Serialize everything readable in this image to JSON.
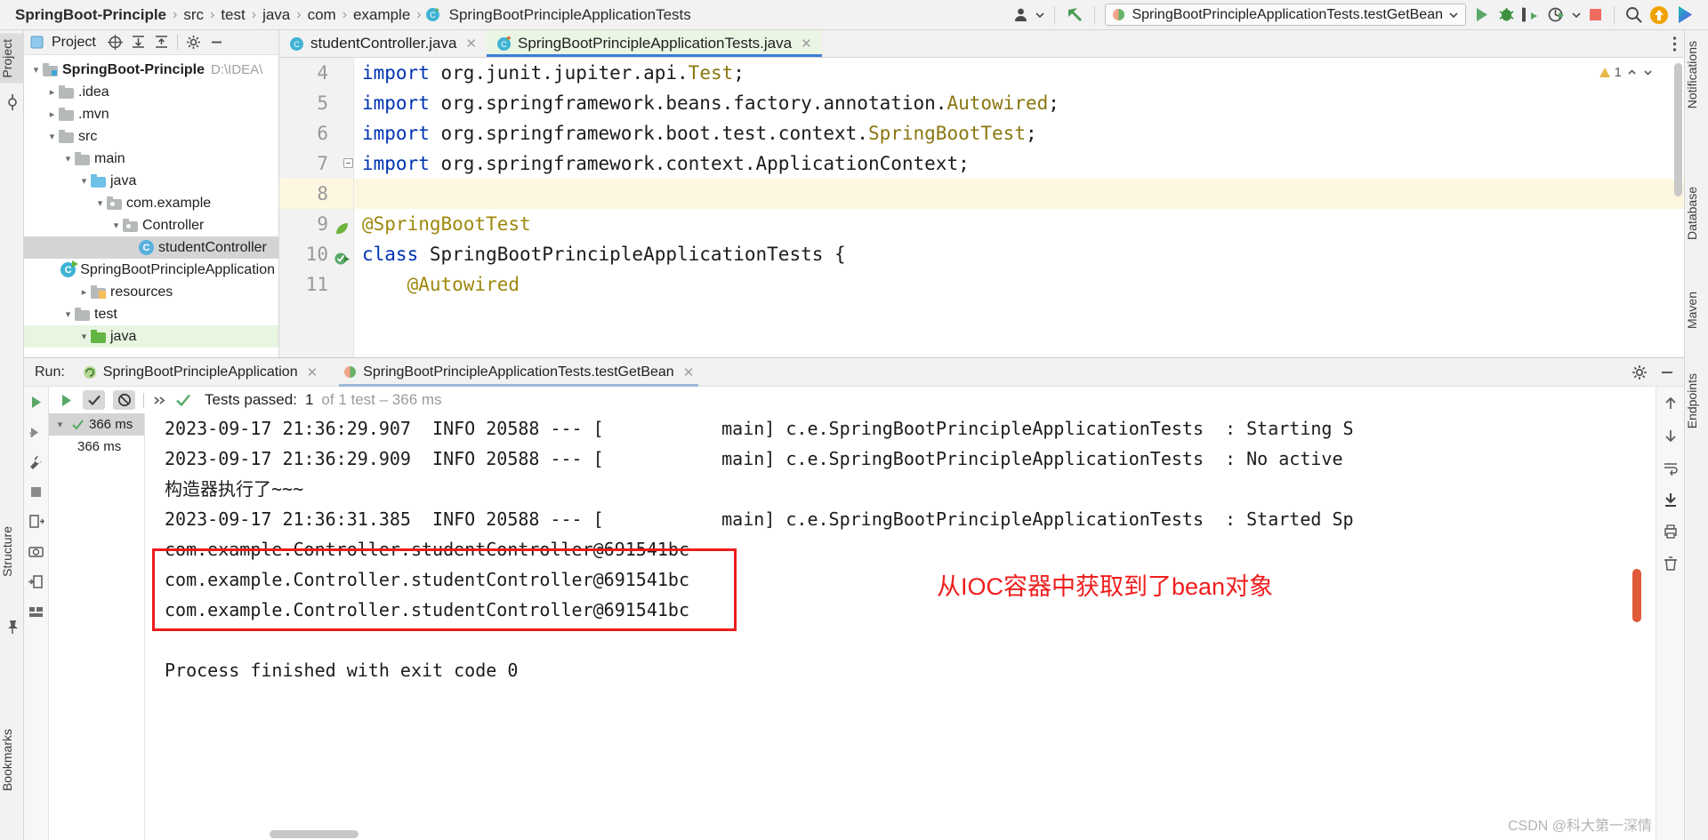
{
  "breadcrumb": {
    "items": [
      {
        "label": "SpringBoot-Principle",
        "bold": true,
        "icon": null
      },
      {
        "label": "src",
        "bold": false,
        "icon": null
      },
      {
        "label": "test",
        "bold": false,
        "icon": null
      },
      {
        "label": "java",
        "bold": false,
        "icon": null
      },
      {
        "label": "com",
        "bold": false,
        "icon": null
      },
      {
        "label": "example",
        "bold": false,
        "icon": null
      },
      {
        "label": "SpringBootPrincipleApplicationTests",
        "bold": false,
        "icon": "class-icon"
      }
    ],
    "separator": "›"
  },
  "toolbar": {
    "account_icon": "user-icon",
    "back_icon": "back-arrow-icon",
    "run_config": "SpringBootPrincipleApplicationTests.testGetBean",
    "run_config_icon": "test-run-icon",
    "dropdown_icon": "chevron-down-icon",
    "run_icon": "run-icon",
    "debug_icon": "debug-icon",
    "coverage_icon": "run-coverage-icon",
    "profile_icon": "profiler-icon",
    "stop_icon": "stop-icon",
    "search_icon": "search-icon",
    "update_icon": "update-badge-icon",
    "ai_icon": "ai-assistant-icon"
  },
  "left_strip": {
    "project_tab": "Project",
    "structure_tab": "Structure",
    "bookmarks_tab": "Bookmarks",
    "commit_icon": "commit-icon",
    "pin_icon": "pin-icon"
  },
  "right_strip": {
    "notifications_tab": "Notifications",
    "database_tab": "Database",
    "maven_tab": "Maven",
    "endpoints_tab": "Endpoints"
  },
  "project_panel": {
    "title": "Project",
    "locate_icon": "locate-icon",
    "expand_icon": "expand-all-icon",
    "collapse_icon": "collapse-all-icon",
    "settings_icon": "gear-icon",
    "hide_icon": "hide-icon",
    "tree": [
      {
        "label": "SpringBoot-Principle",
        "path": "D:\\IDEA\\",
        "depth": 0,
        "chev": "v",
        "icon": "module-folder",
        "bold": true,
        "state": "none"
      },
      {
        "label": ".idea",
        "path": "",
        "depth": 1,
        "chev": ">",
        "icon": "folder",
        "bold": false,
        "state": "none"
      },
      {
        "label": ".mvn",
        "path": "",
        "depth": 1,
        "chev": ">",
        "icon": "folder",
        "bold": false,
        "state": "none"
      },
      {
        "label": "src",
        "path": "",
        "depth": 1,
        "chev": "v",
        "icon": "folder",
        "bold": false,
        "state": "none"
      },
      {
        "label": "main",
        "path": "",
        "depth": 2,
        "chev": "v",
        "icon": "folder",
        "bold": false,
        "state": "none"
      },
      {
        "label": "java",
        "path": "",
        "depth": 3,
        "chev": "v",
        "icon": "source-folder",
        "bold": false,
        "state": "none"
      },
      {
        "label": "com.example",
        "path": "",
        "depth": 4,
        "chev": "v",
        "icon": "package-folder",
        "bold": false,
        "state": "none"
      },
      {
        "label": "Controller",
        "path": "",
        "depth": 5,
        "chev": "v",
        "icon": "package-folder",
        "bold": false,
        "state": "none"
      },
      {
        "label": "studentController",
        "path": "",
        "depth": 6,
        "chev": "",
        "icon": "class-file",
        "bold": false,
        "state": "selected"
      },
      {
        "label": "SpringBootPrincipleApplication",
        "path": "",
        "depth": 6,
        "chev": "",
        "icon": "spring-class-file",
        "bold": false,
        "state": "none"
      },
      {
        "label": "resources",
        "path": "",
        "depth": 3,
        "chev": ">",
        "icon": "resource-folder",
        "bold": false,
        "state": "none"
      },
      {
        "label": "test",
        "path": "",
        "depth": 2,
        "chev": "v",
        "icon": "folder",
        "bold": false,
        "state": "none"
      },
      {
        "label": "java",
        "path": "",
        "depth": 3,
        "chev": "v",
        "icon": "test-source-folder",
        "bold": false,
        "state": "green"
      }
    ]
  },
  "editor": {
    "tabs": [
      {
        "label": "studentController.java",
        "icon": "class-icon",
        "active": false
      },
      {
        "label": "SpringBootPrincipleApplicationTests.java",
        "icon": "spring-class-icon",
        "active": true
      }
    ],
    "warning_count": "1",
    "warning_icon": "warning-icon",
    "up_icon": "chevron-up-icon",
    "down_icon": "chevron-down-icon",
    "more_icon": "more-options-icon",
    "lines": [
      {
        "num": "4",
        "gutter": "",
        "caret": false,
        "fold": false,
        "tokens": [
          {
            "t": "import ",
            "c": "kw"
          },
          {
            "t": "org.junit.jupiter.api.",
            "c": "plain"
          },
          {
            "t": "Test",
            "c": "cl"
          },
          {
            "t": ";",
            "c": "plain"
          }
        ]
      },
      {
        "num": "5",
        "gutter": "",
        "caret": false,
        "fold": false,
        "tokens": [
          {
            "t": "import ",
            "c": "kw"
          },
          {
            "t": "org.springframework.beans.factory.annotation.",
            "c": "plain"
          },
          {
            "t": "Autowired",
            "c": "cl"
          },
          {
            "t": ";",
            "c": "plain"
          }
        ]
      },
      {
        "num": "6",
        "gutter": "",
        "caret": false,
        "fold": false,
        "tokens": [
          {
            "t": "import ",
            "c": "kw"
          },
          {
            "t": "org.springframework.boot.test.context.",
            "c": "plain"
          },
          {
            "t": "SpringBootTest",
            "c": "cl"
          },
          {
            "t": ";",
            "c": "plain"
          }
        ]
      },
      {
        "num": "7",
        "gutter": "",
        "caret": false,
        "fold": true,
        "tokens": [
          {
            "t": "import ",
            "c": "kw"
          },
          {
            "t": "org.springframework.context.ApplicationContext;",
            "c": "plain"
          }
        ]
      },
      {
        "num": "8",
        "gutter": "",
        "caret": true,
        "fold": false,
        "tokens": []
      },
      {
        "num": "9",
        "gutter": "spring-bean-icon",
        "caret": false,
        "fold": false,
        "tokens": [
          {
            "t": "@SpringBootTest",
            "c": "anno"
          }
        ]
      },
      {
        "num": "10",
        "gutter": "run-test-icon",
        "caret": false,
        "fold": false,
        "tokens": [
          {
            "t": "class ",
            "c": "kw"
          },
          {
            "t": "SpringBootPrincipleApplicationTests {",
            "c": "plain"
          }
        ]
      },
      {
        "num": "11",
        "gutter": "",
        "caret": false,
        "fold": false,
        "tokens": [
          {
            "t": "    @Autowired",
            "c": "anno"
          }
        ]
      }
    ]
  },
  "run_window": {
    "caption": "Run:",
    "tabs": [
      {
        "label": "SpringBootPrincipleApplication",
        "icon": "spring-run-icon",
        "active": false
      },
      {
        "label": "SpringBootPrincipleApplicationTests.testGetBean",
        "icon": "test-run-icon",
        "active": true
      }
    ],
    "settings_icon": "gear-icon",
    "minimize_icon": "minimize-icon",
    "rerun_icon": "rerun-icon",
    "toggle_passed_icon": "show-passed-icon",
    "toggle_ignored_icon": "show-ignored-icon",
    "expand_icon": "expand-icon",
    "status_prefix": "Tests passed:",
    "status_count": "1",
    "status_suffix": "of 1 test – 366 ms",
    "status_icon": "check-icon",
    "test_tree": [
      {
        "label": "366 ms",
        "chev": "v",
        "icon": "check-icon",
        "selected": true
      },
      {
        "label": "366 ms",
        "chev": "",
        "icon": "",
        "selected": false
      }
    ],
    "console_lines": [
      "2023-09-17 21:36:29.907  INFO 20588 --- [           main] c.e.SpringBootPrincipleApplicationTests  : Starting S",
      "2023-09-17 21:36:29.909  INFO 20588 --- [           main] c.e.SpringBootPrincipleApplicationTests  : No active",
      "构造器执行了~~~",
      "2023-09-17 21:36:31.385  INFO 20588 --- [           main] c.e.SpringBootPrincipleApplicationTests  : Started Sp",
      "com.example.Controller.studentController@691541bc",
      "com.example.Controller.studentController@691541bc",
      "com.example.Controller.studentController@691541bc",
      "",
      "Process finished with exit code 0"
    ],
    "annotation": "从IOC容器中获取到了bean对象",
    "annotation_color": "#f01d1d",
    "highlight_box_color": "#ee1c1c",
    "side_icons": {
      "scroll_up": "scroll-up-icon",
      "scroll_down": "scroll-down-icon",
      "soft_wrap": "soft-wrap-icon",
      "scroll_end": "scroll-to-end-icon",
      "print": "print-icon",
      "trash": "clear-all-icon",
      "camera": "screenshot-icon",
      "export": "export-icon",
      "layout": "layout-icon",
      "wrench": "settings-wrench-icon",
      "stop": "stop-square-icon"
    }
  },
  "watermark": "CSDN @科大第一深情"
}
